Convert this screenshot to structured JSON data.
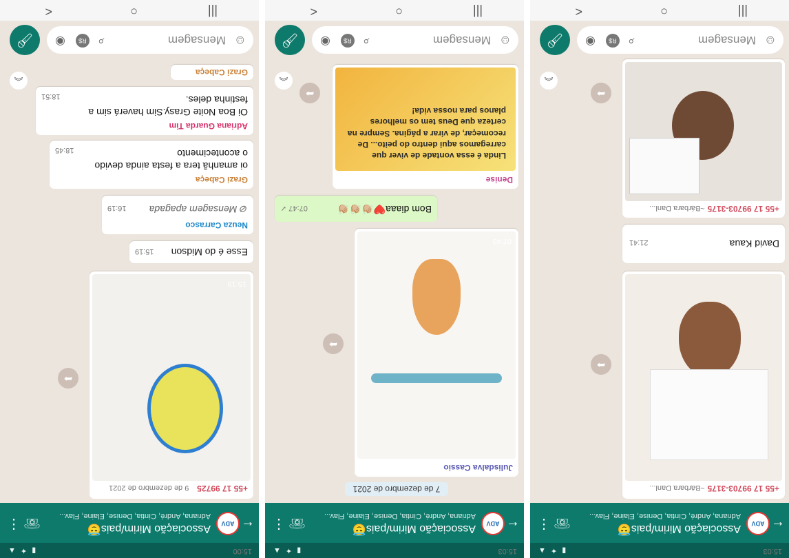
{
  "chat": {
    "group_name": "Associação Mirim/pais",
    "group_emoji": "😇",
    "members": "Adriana, André, Cíntia, Denise, Elaine, Flav...",
    "avatar_label": "ADV"
  },
  "composer": {
    "placeholder": "Mensagem"
  },
  "phones": [
    {
      "status_time": "15:03",
      "messages": [
        {
          "sender": "+55 17 99703-3175",
          "alias": "~Bárbara Danl...",
          "time": ""
        },
        {
          "caption": "David Kaua",
          "time": "21:41"
        },
        {
          "sender": "+55 17 99703-3175",
          "alias": "~Bárbara Danl..."
        }
      ]
    },
    {
      "status_time": "15:03",
      "date": "7 de dezembro de 2021",
      "messages": [
        {
          "sender": "Julisdalva Cassio",
          "time": "07:45"
        },
        {
          "text": "Bom diaaa❤️👏🏼👏🏼👏🏼",
          "time": "07:47 ✓"
        },
        {
          "sender": "Denise",
          "text": "Linda é essa vontade de viver que carregamos aqui dentro do peito... De recomeçar, de virar a página. Sempre na certeza que Deus tem os melhores planos para nossa vida!"
        }
      ]
    },
    {
      "status_time": "15:00",
      "date": "9 de dezembro de 2021",
      "messages": [
        {
          "sender": "+55 17 99725",
          "time": "15:19"
        },
        {
          "text": "Esse é do Midson",
          "time": "15:19"
        },
        {
          "sender": "Neuza Carrasco",
          "text": "Mensagem apagada",
          "time": "16:19"
        },
        {
          "sender": "Grazi Cabeça",
          "text": "oi amanhã tera a festa ainda devido o acontecimento",
          "time": "18:45"
        },
        {
          "sender": "Adriana Guarda Tim",
          "text": "Oi Boa Noite Grasy.Sim haverá sim a festinha deles.",
          "time": "18:51"
        },
        {
          "sender": "Grazi Cabeça"
        }
      ]
    }
  ],
  "colors": {
    "header": "#0e7a6c",
    "status": "#0a5d53",
    "chat_bg": "#ece5dd",
    "out_bubble": "#dcf8c6"
  }
}
